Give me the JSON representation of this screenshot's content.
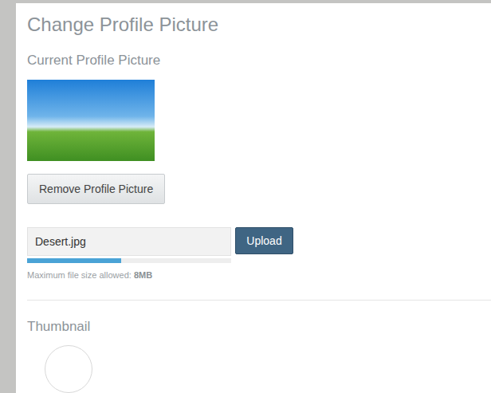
{
  "page": {
    "title": "Change Profile Picture"
  },
  "current": {
    "heading": "Current Profile Picture",
    "remove_button": "Remove Profile Picture"
  },
  "upload": {
    "file_name": "Desert.jpg",
    "button": "Upload",
    "level": 0.46,
    "limit_label": "Maximum file size allowed: ",
    "limit_value": "8MB"
  },
  "thumbnail": {
    "heading": "Thumbnail"
  }
}
